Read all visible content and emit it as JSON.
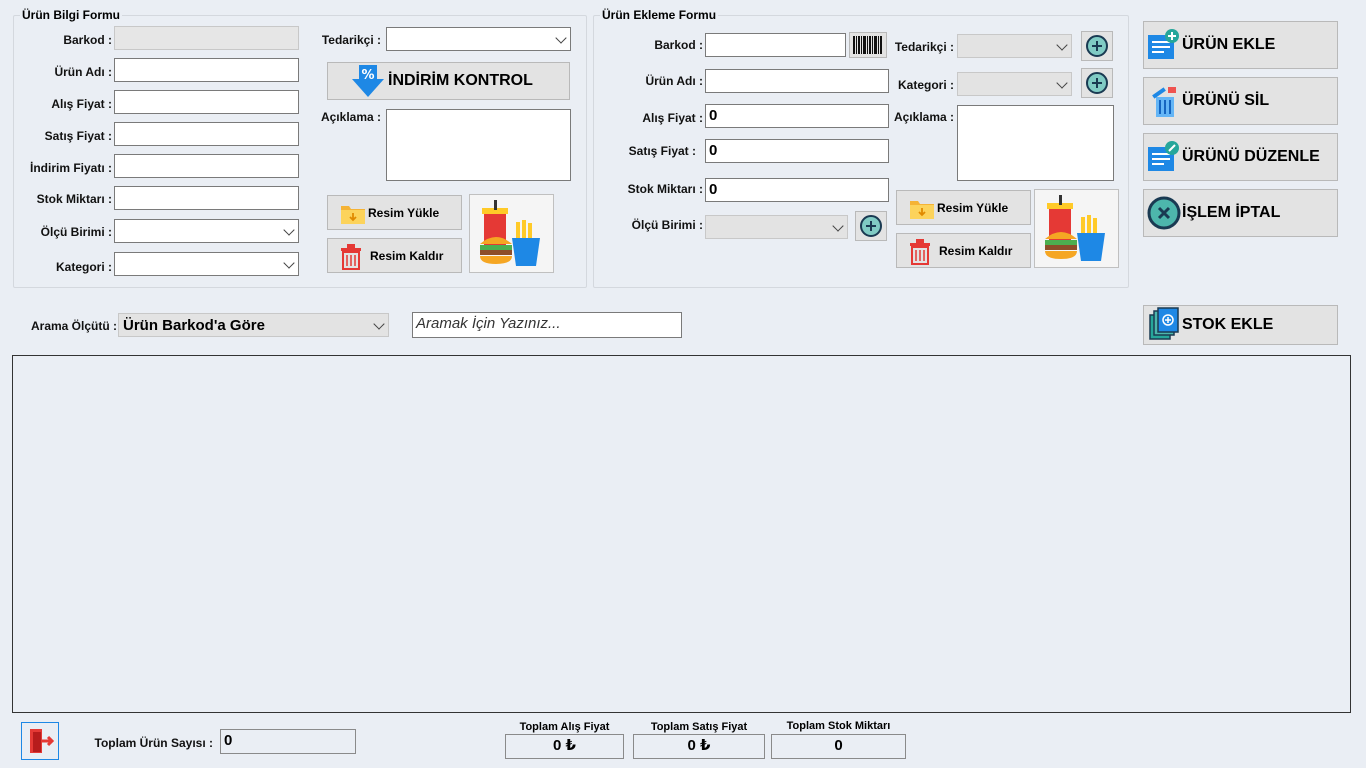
{
  "info_form": {
    "title": "Ürün Bilgi Formu",
    "barkod_label": "Barkod :",
    "urun_adi_label": "Ürün Adı :",
    "alis_fiyat_label": "Alış Fiyat :",
    "satis_fiyat_label": "Satış Fiyat :",
    "indirim_fiyati_label": "İndirim Fiyatı :",
    "stok_miktari_label": "Stok Miktarı :",
    "olcu_birimi_label": "Ölçü Birimi :",
    "kategori_label": "Kategori :",
    "tedarikci_label": "Tedarikçi :",
    "aciklama_label": "Açıklama :",
    "indirim_kontrol_label": "İNDİRİM KONTROL",
    "resim_yukle_label": "Resim Yükle",
    "resim_kaldir_label": "Resim Kaldır"
  },
  "add_form": {
    "title": "Ürün Ekleme Formu",
    "barkod_label": "Barkod :",
    "urun_adi_label": "Ürün Adı :",
    "alis_fiyat_label": "Alış Fiyat :",
    "satis_fiyat_label": "Satış Fiyat :",
    "stok_miktari_label": "Stok Miktarı :",
    "olcu_birimi_label": "Ölçü Birimi :",
    "tedarikci_label": "Tedarikçi :",
    "kategori_label": "Kategori :",
    "aciklama_label": "Açıklama :",
    "alis_fiyat_value": "0",
    "satis_fiyat_value": "0",
    "stok_miktari_value": "0",
    "resim_yukle_label": "Resim Yükle",
    "resim_kaldir_label": "Resim Kaldır"
  },
  "actions": {
    "urun_ekle": "ÜRÜN EKLE",
    "urunu_sil": "ÜRÜNÜ SİL",
    "urunu_duzenle": "ÜRÜNÜ DÜZENLE",
    "islem_iptal": "İŞLEM İPTAL",
    "stok_ekle": "STOK EKLE"
  },
  "search": {
    "criteria_label": "Arama Ölçütü :",
    "criteria_value": "Ürün Barkod'a Göre",
    "placeholder": "Aramak İçin Yazınız..."
  },
  "footer": {
    "toplam_urun_sayisi_label": "Toplam Ürün Sayısı :",
    "toplam_urun_sayisi_value": "0",
    "toplam_alis_fiyat_label": "Toplam Alış Fiyat",
    "toplam_alis_fiyat_value": "0 ₺",
    "toplam_satis_fiyat_label": "Toplam Satış Fiyat",
    "toplam_satis_fiyat_value": "0 ₺",
    "toplam_stok_miktari_label": "Toplam Stok Miktarı",
    "toplam_stok_miktari_value": "0"
  },
  "colors": {
    "background": "#eaeef4",
    "button": "#e3e3e3",
    "accent_blue": "#1e88e5",
    "accent_teal": "#26a69a",
    "exit_red": "#e53935"
  }
}
